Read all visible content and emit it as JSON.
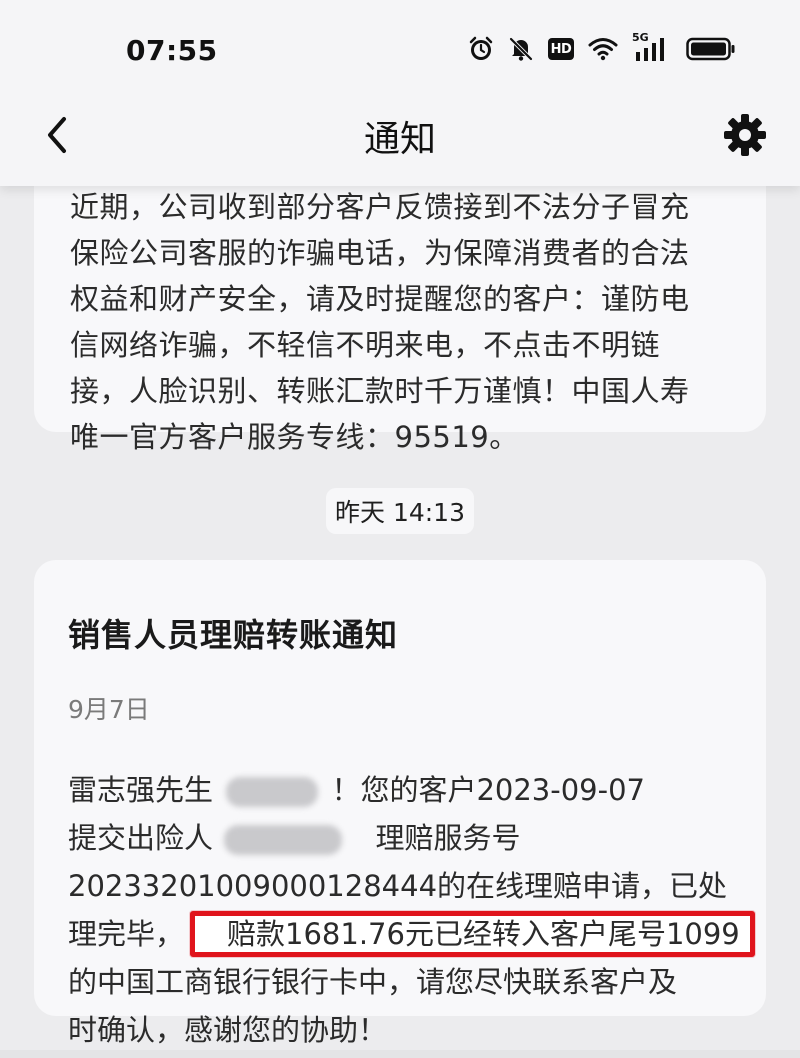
{
  "status_bar": {
    "time": "07:55",
    "icons": [
      "alarm-icon",
      "mute-bell-icon",
      "hd-badge",
      "wifi-icon",
      "signal-5g-icon",
      "battery-icon"
    ],
    "hd_label": "HD",
    "network_label": "5G"
  },
  "nav": {
    "title": "通知",
    "back_icon": "chevron-left-icon",
    "settings_icon": "gear-icon"
  },
  "previous_notification": {
    "lines": [
      "近期，公司收到部分客户反馈接到不法分子冒充",
      "保险公司客服的诈骗电话，为保障消费者的合法",
      "权益和财产安全，请及时提醒您的客户：谨防电",
      "信网络诈骗，不轻信不明来电，不点击不明链",
      "接，人脸识别、转账汇款时千万谨慎！中国人寿",
      "唯一官方客户服务专线：95519。"
    ]
  },
  "timestamp": "昨天 14:13",
  "notification": {
    "title": "销售人员理赔转账通知",
    "date": "9月7日",
    "body": {
      "line1_a": "雷志强先生",
      "line1_b": "！您的客户2023-09-07",
      "line2_a": "提交出险人",
      "line2_b": "理赔服务号",
      "line3": "20233201009000128444的在线理赔申请，已处",
      "line4_a": "理完毕，",
      "line4_highlight": "赔款1681.76元已经转入客户尾号1099",
      "line5": "的中国工商银行银行卡中，请您尽快联系客户及",
      "line6": "时确认，感谢您的协助！"
    }
  },
  "colors": {
    "background": "#ececee",
    "card": "#f8f8fa",
    "highlight_border": "#e0141c"
  }
}
